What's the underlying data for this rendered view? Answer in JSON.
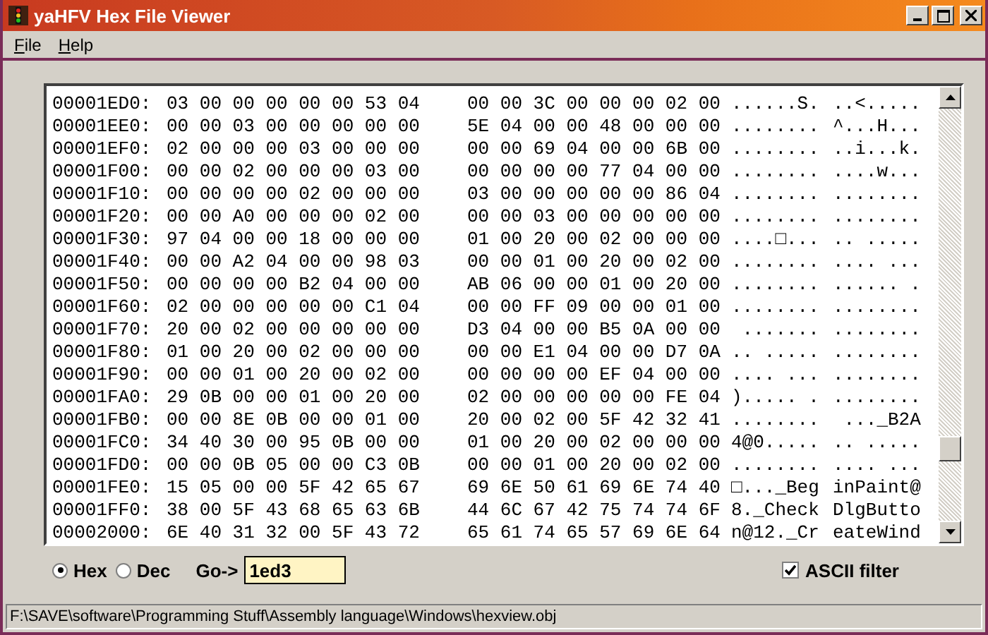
{
  "window": {
    "title": "yaHFV Hex File Viewer"
  },
  "menu": [
    {
      "label": "File"
    },
    {
      "label": "Help"
    }
  ],
  "rows": [
    {
      "address": "00001ED0:",
      "hex_left": "03 00 00 00 00 00 53 04",
      "hex_right": "00 00 3C 00 00 00 02 00",
      "ascii_left": "......S.",
      "ascii_right": "..<....."
    },
    {
      "address": "00001EE0:",
      "hex_left": "00 00 03 00 00 00 00 00",
      "hex_right": "5E 04 00 00 48 00 00 00",
      "ascii_left": "........",
      "ascii_right": "^...H..."
    },
    {
      "address": "00001EF0:",
      "hex_left": "02 00 00 00 03 00 00 00",
      "hex_right": "00 00 69 04 00 00 6B 00",
      "ascii_left": "........",
      "ascii_right": "..i...k."
    },
    {
      "address": "00001F00:",
      "hex_left": "00 00 02 00 00 00 03 00",
      "hex_right": "00 00 00 00 77 04 00 00",
      "ascii_left": "........",
      "ascii_right": "....w..."
    },
    {
      "address": "00001F10:",
      "hex_left": "00 00 00 00 02 00 00 00",
      "hex_right": "03 00 00 00 00 00 86 04",
      "ascii_left": "........",
      "ascii_right": "........"
    },
    {
      "address": "00001F20:",
      "hex_left": "00 00 A0 00 00 00 02 00",
      "hex_right": "00 00 03 00 00 00 00 00",
      "ascii_left": "........",
      "ascii_right": "........"
    },
    {
      "address": "00001F30:",
      "hex_left": "97 04 00 00 18 00 00 00",
      "hex_right": "01 00 20 00 02 00 00 00",
      "ascii_left": "....□...",
      "ascii_right": ".. ....."
    },
    {
      "address": "00001F40:",
      "hex_left": "00 00 A2 04 00 00 98 03",
      "hex_right": "00 00 01 00 20 00 02 00",
      "ascii_left": "........",
      "ascii_right": ".... ..."
    },
    {
      "address": "00001F50:",
      "hex_left": "00 00 00 00 B2 04 00 00",
      "hex_right": "AB 06 00 00 01 00 20 00",
      "ascii_left": "........",
      "ascii_right": "...... ."
    },
    {
      "address": "00001F60:",
      "hex_left": "02 00 00 00 00 00 C1 04",
      "hex_right": "00 00 FF 09 00 00 01 00",
      "ascii_left": "........",
      "ascii_right": "........"
    },
    {
      "address": "00001F70:",
      "hex_left": "20 00 02 00 00 00 00 00",
      "hex_right": "D3 04 00 00 B5 0A 00 00",
      "ascii_left": " .......",
      "ascii_right": "........"
    },
    {
      "address": "00001F80:",
      "hex_left": "01 00 20 00 02 00 00 00",
      "hex_right": "00 00 E1 04 00 00 D7 0A",
      "ascii_left": ".. .....",
      "ascii_right": "........"
    },
    {
      "address": "00001F90:",
      "hex_left": "00 00 01 00 20 00 02 00",
      "hex_right": "00 00 00 00 EF 04 00 00",
      "ascii_left": ".... ...",
      "ascii_right": "........"
    },
    {
      "address": "00001FA0:",
      "hex_left": "29 0B 00 00 01 00 20 00",
      "hex_right": "02 00 00 00 00 00 FE 04",
      "ascii_left": ")..... .",
      "ascii_right": "........"
    },
    {
      "address": "00001FB0:",
      "hex_left": "00 00 8E 0B 00 00 01 00",
      "hex_right": "20 00 02 00 5F 42 32 41",
      "ascii_left": "........",
      "ascii_right": " ..._B2A"
    },
    {
      "address": "00001FC0:",
      "hex_left": "34 40 30 00 95 0B 00 00",
      "hex_right": "01 00 20 00 02 00 00 00",
      "ascii_left": "4@0.....",
      "ascii_right": ".. ....."
    },
    {
      "address": "00001FD0:",
      "hex_left": "00 00 0B 05 00 00 C3 0B",
      "hex_right": "00 00 01 00 20 00 02 00",
      "ascii_left": "........",
      "ascii_right": ".... ..."
    },
    {
      "address": "00001FE0:",
      "hex_left": "15 05 00 00 5F 42 65 67",
      "hex_right": "69 6E 50 61 69 6E 74 40",
      "ascii_left": "□..._Beg",
      "ascii_right": "inPaint@"
    },
    {
      "address": "00001FF0:",
      "hex_left": "38 00 5F 43 68 65 63 6B",
      "hex_right": "44 6C 67 42 75 74 74 6F",
      "ascii_left": "8._Check",
      "ascii_right": "DlgButto"
    },
    {
      "address": "00002000:",
      "hex_left": "6E 40 31 32 00 5F 43 72",
      "hex_right": "65 61 74 65 57 69 6E 64",
      "ascii_left": "n@12._Cr",
      "ascii_right": "eateWind"
    }
  ],
  "radix": [
    {
      "label": "Hex",
      "selected": true
    },
    {
      "label": "Dec",
      "selected": false
    }
  ],
  "goto": {
    "label": "Go->",
    "value": "1ed3"
  },
  "ascii_filter": {
    "label": "ASCII filter",
    "checked": true
  },
  "status_bar": "F:\\SAVE\\software\\Programming Stuff\\Assembly language\\Windows\\hexview.obj"
}
